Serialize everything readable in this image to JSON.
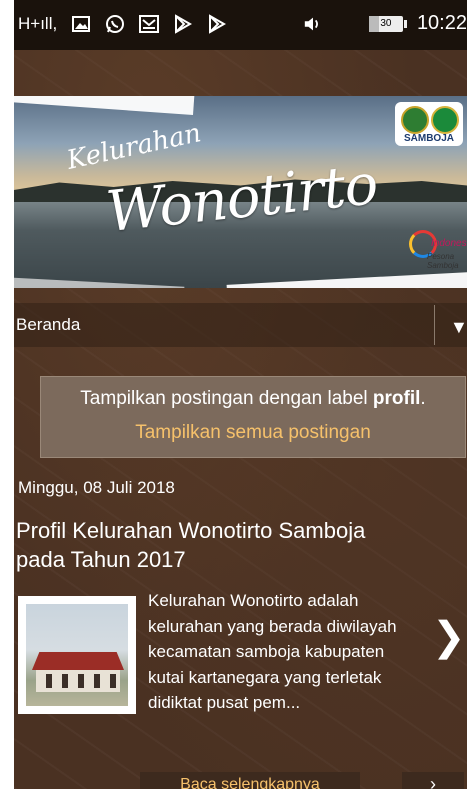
{
  "status_bar": {
    "signal_text": "H+ıll,",
    "icons": [
      "image-icon",
      "whatsapp-icon",
      "mail-icon",
      "play-store-icon",
      "play-store-icon",
      "volume-icon"
    ],
    "battery_level": "30",
    "time": "10:22"
  },
  "banner": {
    "line1": "Kelurahan",
    "line2": "Wonotirto",
    "logo_caption": "SAMBOJA",
    "tourism_brand": "Indonesia",
    "tourism_sub": "Pesona Samboja"
  },
  "nav": {
    "selected": "Beranda",
    "arrow": "▼"
  },
  "label_notice": {
    "prefix": "Tampilkan postingan dengan label ",
    "label": "profil",
    "suffix": ".",
    "show_all": "Tampilkan semua postingan"
  },
  "post": {
    "date": "Minggu, 08 Juli 2018",
    "title": "Profil Kelurahan Wonotirto Samboja pada Tahun 2017",
    "excerpt": "Kelurahan Wonotirto adalah kelurahan yang berada diwilayah kecamatan samboja kabupaten kutai kartanegara yang terletak didiktat pusat pem...",
    "next_glyph": "❯"
  },
  "footer": {
    "read_more": "Baca selengkapnya",
    "share_glyph": "›"
  },
  "colors": {
    "background": "#4a3122",
    "link": "#f6c16b",
    "notice_bg": "#7c6a5c"
  }
}
